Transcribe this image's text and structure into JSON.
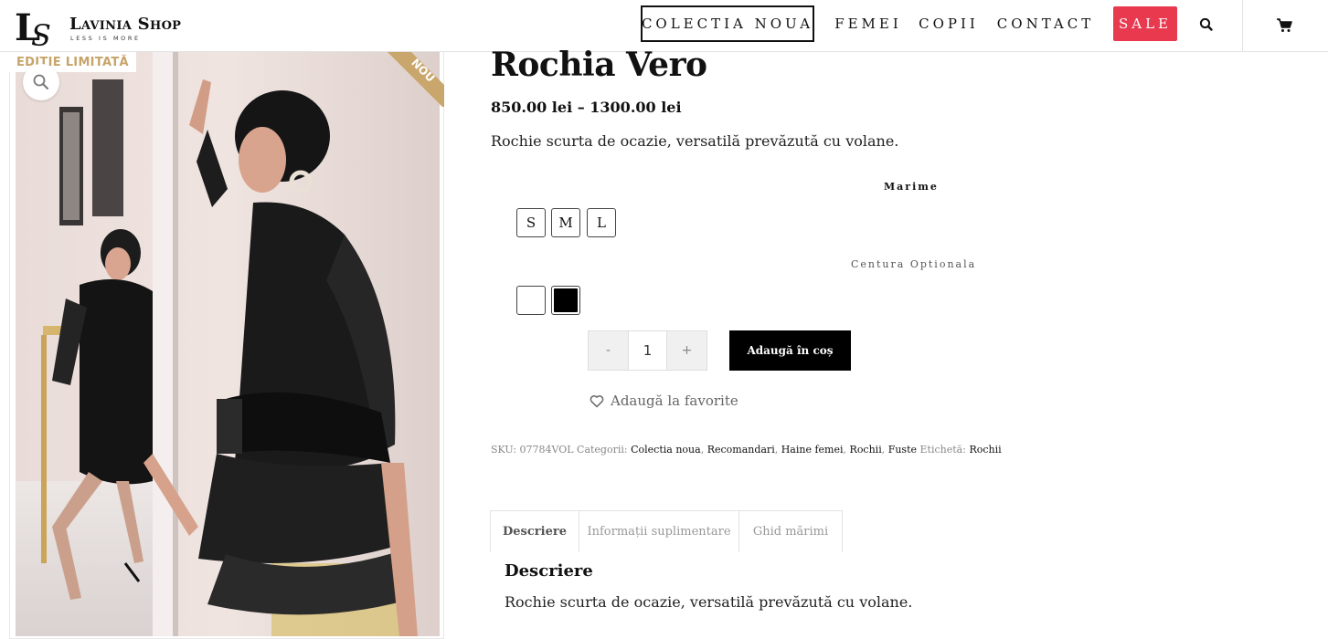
{
  "header": {
    "logo_name": "Lavinia Shop",
    "logo_tagline": "LESS IS MORE",
    "nav": {
      "colectia": "COLECTIA NOUA",
      "femei": "FEMEI",
      "copii": "COPII",
      "contact": "CONTACT",
      "sale": "SALE"
    },
    "icons": {
      "search": "search-icon",
      "cart": "cart-icon"
    },
    "sale_color": "#e8394f"
  },
  "gallery": {
    "badge_limited": "EDIȚIE LIMITATĂ",
    "ribbon_new": "NOU",
    "badge_color": "#c7a46a",
    "zoom_icon": "magnifier-icon"
  },
  "product": {
    "title": "Rochia Vero",
    "price": "850.00 lei – 1300.00 lei",
    "short_description": "Rochie scurta de ocazie, versatilă prevăzută cu volane.",
    "attributes": {
      "size_label": "Marime",
      "sizes": [
        "S",
        "M",
        "L"
      ],
      "belt_label": "Centura Optionala",
      "belt_colors": [
        "#ffffff",
        "#000000"
      ]
    },
    "quantity": {
      "minus": "-",
      "value": "1",
      "plus": "+"
    },
    "add_to_cart": "Adaugă în coș",
    "add_to_favorites": "Adaugă la favorite",
    "meta": {
      "sku_label": "SKU:",
      "sku": "07784VOL",
      "categories_label": "Categorii:",
      "categories": [
        "Colectia noua",
        "Recomandari",
        "Haine femei",
        "Rochii",
        "Fuste"
      ],
      "tag_label": "Etichetă:",
      "tag": "Rochii"
    }
  },
  "tabs": {
    "items": [
      "Descriere",
      "Informații suplimentare",
      "Ghid mărimi"
    ],
    "active_title": "Descriere",
    "active_text": "Rochie scurta de ocazie, versatilă prevăzută cu volane."
  }
}
